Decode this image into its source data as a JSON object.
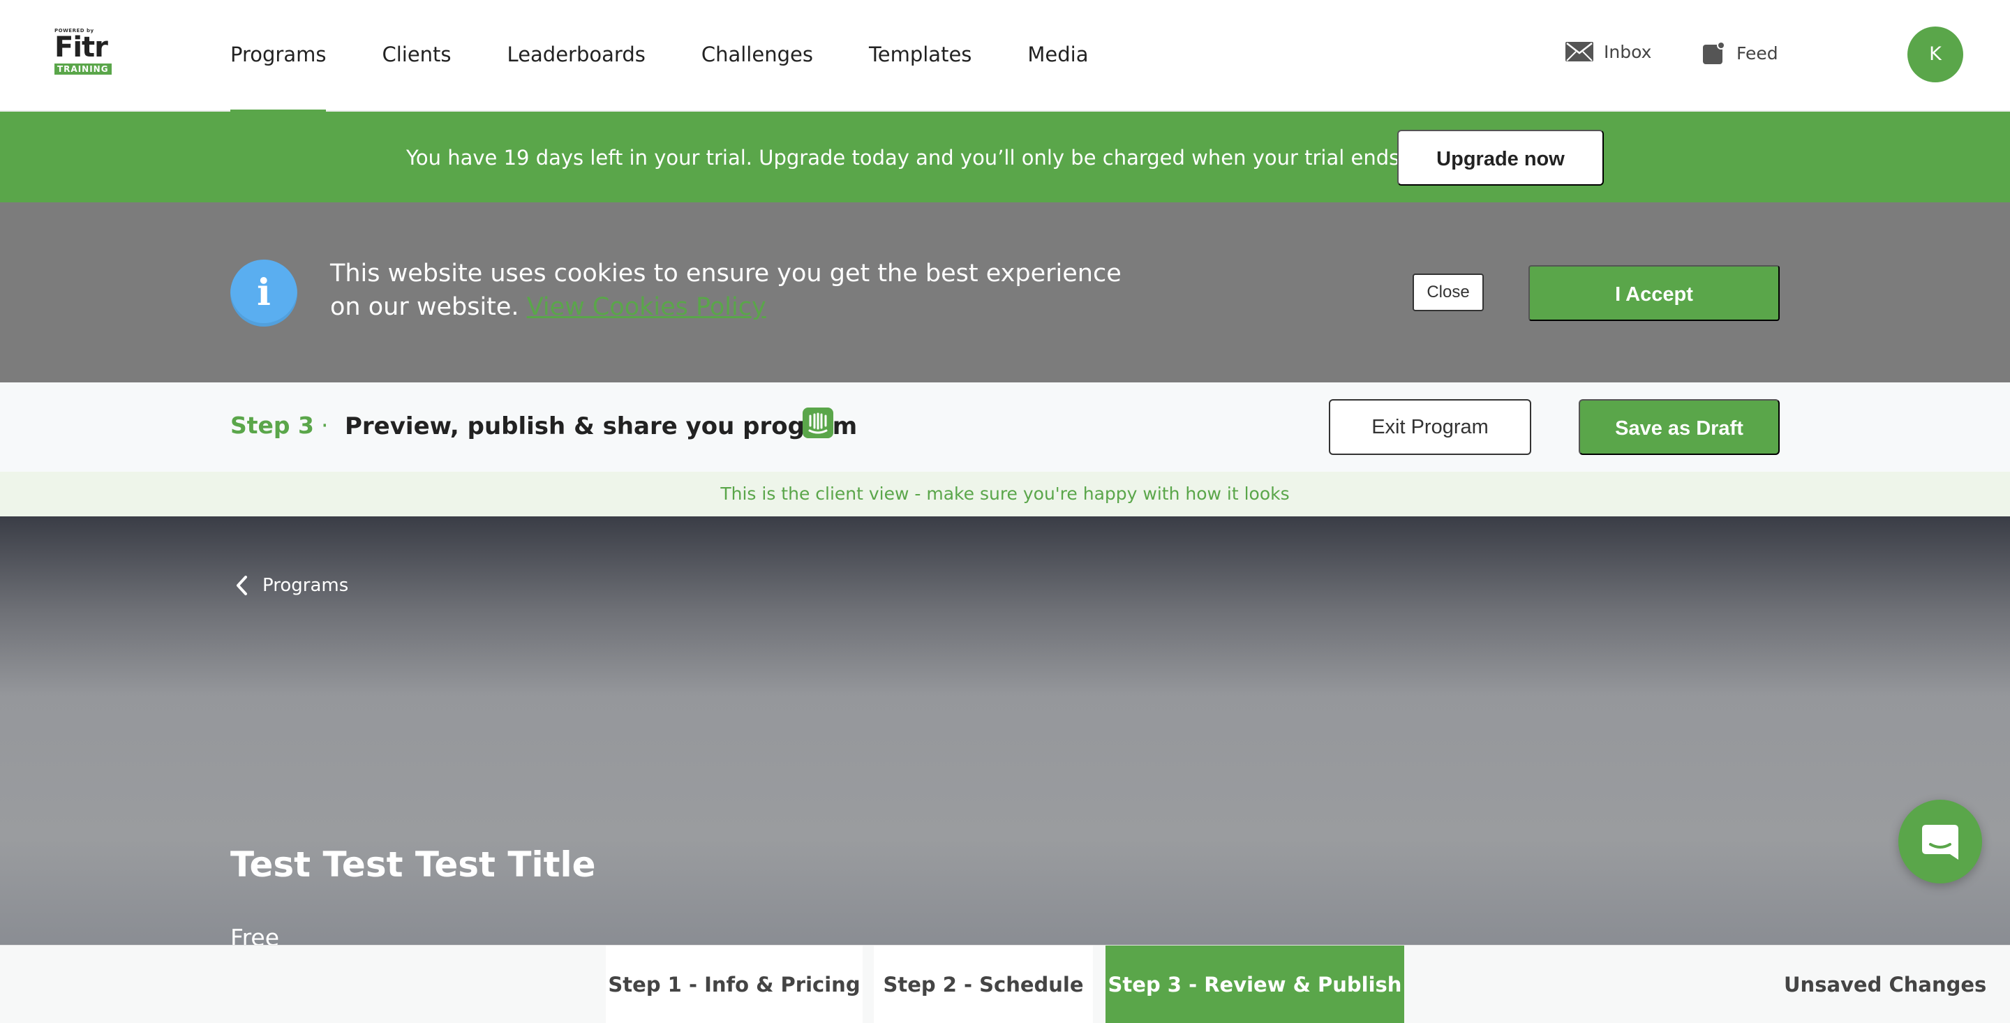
{
  "nav": {
    "logo": {
      "powered": "POWERED by",
      "word": "Fitr",
      "tag": "TRAINING"
    },
    "links": [
      {
        "label": "Programs",
        "active": true
      },
      {
        "label": "Clients"
      },
      {
        "label": "Leaderboards"
      },
      {
        "label": "Challenges"
      },
      {
        "label": "Templates"
      },
      {
        "label": "Media"
      }
    ],
    "inbox_label": "Inbox",
    "feed_label": "Feed",
    "avatar_initial": "K"
  },
  "trial": {
    "message": "You have 19 days left in your trial. Upgrade today and you’ll only be charged when your trial ends.",
    "upgrade_label": "Upgrade now"
  },
  "cookie": {
    "message": "This website uses cookies to ensure you get the best experience on our website.",
    "policy_link": "View Cookies Policy",
    "close_label": "Close",
    "accept_label": "I Accept"
  },
  "step": {
    "label": "Step 3",
    "separator": "·",
    "title": "Preview, publish & share you program",
    "exit_label": "Exit Program",
    "draft_label": "Save as Draft",
    "client_view_note": "This is the client view - make sure you're happy with how it looks"
  },
  "hero": {
    "back_label": "Programs",
    "title": "Test Test Test Title",
    "price": "Free"
  },
  "bottom": {
    "tabs": [
      {
        "label": "Step 1 - Info & Pricing"
      },
      {
        "label": "Step 2 - Schedule"
      },
      {
        "label": "Step 3 - Review & Publish",
        "active": true
      }
    ],
    "status": "Unsaved Changes"
  },
  "colors": {
    "brand_green": "#5aa64a",
    "cookie_gray": "#7c7c7c",
    "info_blue": "#5aaef0"
  }
}
